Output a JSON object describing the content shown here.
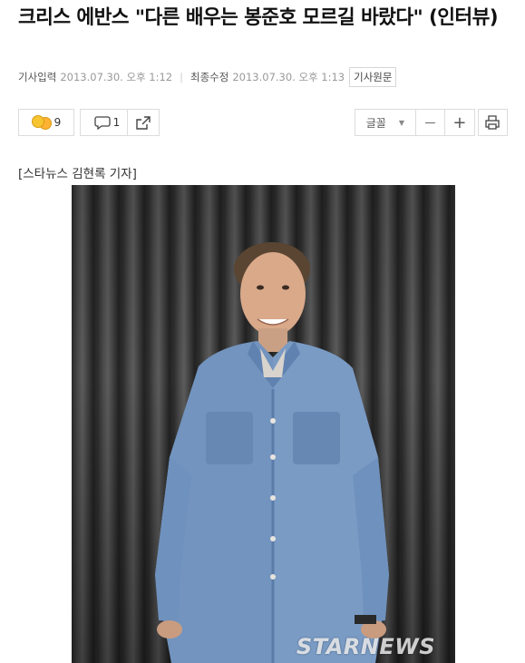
{
  "article": {
    "title": "크리스 에반스 \"다른 배우는 봉준호 모르길 바랐다\" (인터뷰)",
    "input_label": "기사입력",
    "input_time": "2013.07.30. 오후 1:12",
    "modified_label": "최종수정",
    "modified_time": "2013.07.30. 오후 1:13",
    "original_button": "기사원문",
    "reporter": "[스타뉴스 김현록 기자]"
  },
  "toolbar": {
    "reaction_count": "9",
    "comment_count": "1",
    "font_label": "글꼴",
    "minus": "—",
    "plus": "+"
  },
  "photo": {
    "watermark": "STARNEWS"
  }
}
